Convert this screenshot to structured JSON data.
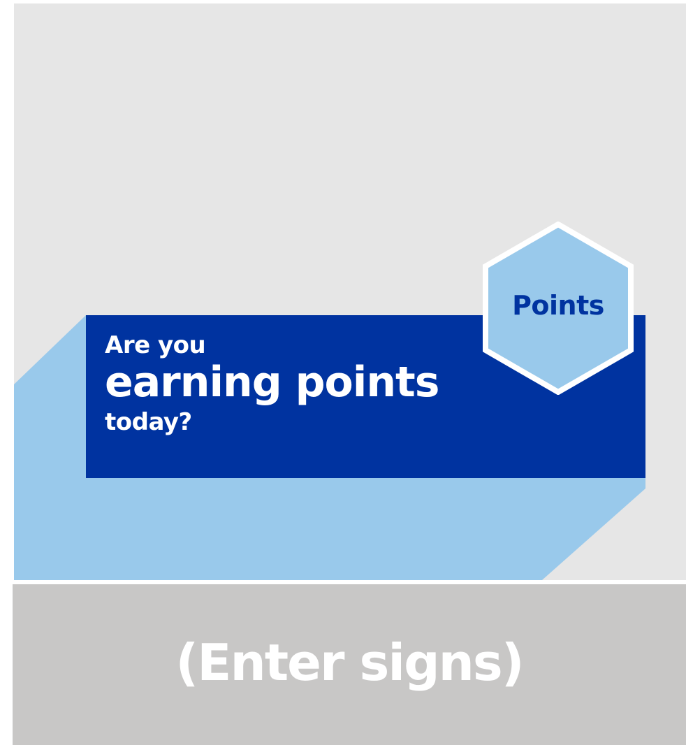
{
  "badge": {
    "label": "Points",
    "icon": "hexagon-icon"
  },
  "banner": {
    "line1": "Are you",
    "line2": "earning points",
    "line3": "today?"
  },
  "footer": {
    "label": "(Enter signs)"
  },
  "colors": {
    "navy": "#0033a0",
    "light_blue": "#99c9eb",
    "panel_gray": "#e6e6e6",
    "footer_gray": "#c8c7c6",
    "white": "#ffffff"
  }
}
